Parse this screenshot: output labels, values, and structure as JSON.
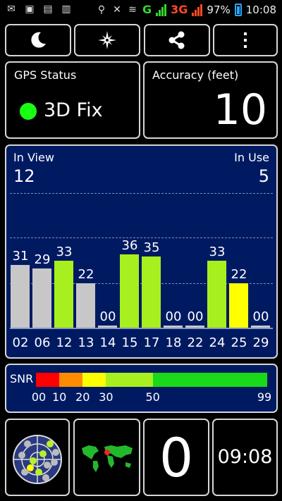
{
  "statusbar": {
    "icons": [
      "gmail-icon",
      "image-icon",
      "briefcase-icon",
      "clipboard-icon",
      "location-icon",
      "mute-icon",
      "wifi-icon"
    ],
    "network_g": "G",
    "network_3g": "3G",
    "battery": "97%",
    "clock": "10:08"
  },
  "toolbar": {
    "buttons": [
      "night-mode",
      "compass",
      "share",
      "overflow-menu"
    ]
  },
  "gps_status": {
    "label": "GPS Status",
    "value": "3D Fix",
    "indicator_color": "#19ff13"
  },
  "accuracy": {
    "label": "Accuracy (feet)",
    "value": "10"
  },
  "satellites": {
    "in_view_label": "In View",
    "in_view": "12",
    "in_use_label": "In Use",
    "in_use": "5",
    "list": [
      {
        "prn": "02",
        "snr": "31",
        "snr_num": 31,
        "color": "#c7c7c7"
      },
      {
        "prn": "06",
        "snr": "29",
        "snr_num": 29,
        "color": "#c7c7c7"
      },
      {
        "prn": "12",
        "snr": "33",
        "snr_num": 33,
        "color": "#a8ef1f"
      },
      {
        "prn": "13",
        "snr": "22",
        "snr_num": 22,
        "color": "#c7c7c7"
      },
      {
        "prn": "14",
        "snr": "00",
        "snr_num": 0,
        "color": "#c7c7c7"
      },
      {
        "prn": "15",
        "snr": "36",
        "snr_num": 36,
        "color": "#a8ef1f"
      },
      {
        "prn": "17",
        "snr": "35",
        "snr_num": 35,
        "color": "#a8ef1f"
      },
      {
        "prn": "18",
        "snr": "00",
        "snr_num": 0,
        "color": "#c7c7c7"
      },
      {
        "prn": "22",
        "snr": "00",
        "snr_num": 0,
        "color": "#c7c7c7"
      },
      {
        "prn": "24",
        "snr": "33",
        "snr_num": 33,
        "color": "#a8ef1f"
      },
      {
        "prn": "25",
        "snr": "22",
        "snr_num": 22,
        "color": "#ffff00"
      },
      {
        "prn": "29",
        "snr": "00",
        "snr_num": 0,
        "color": "#c7c7c7"
      }
    ]
  },
  "snr_scale": {
    "label": "SNR",
    "segments": [
      {
        "from": 0,
        "to": 10,
        "color": "#ff0000"
      },
      {
        "from": 10,
        "to": 20,
        "color": "#ff8c00"
      },
      {
        "from": 20,
        "to": 30,
        "color": "#ffff00"
      },
      {
        "from": 30,
        "to": 50,
        "color": "#a8ef1f"
      },
      {
        "from": 50,
        "to": 99,
        "color": "#19d91a"
      }
    ],
    "ticks": [
      "00",
      "10",
      "20",
      "30",
      "50",
      "99"
    ]
  },
  "bottom": {
    "speed": "0",
    "time": "09:08",
    "radar_icon": "satellite-radar-icon",
    "map_icon": "world-map-icon"
  }
}
